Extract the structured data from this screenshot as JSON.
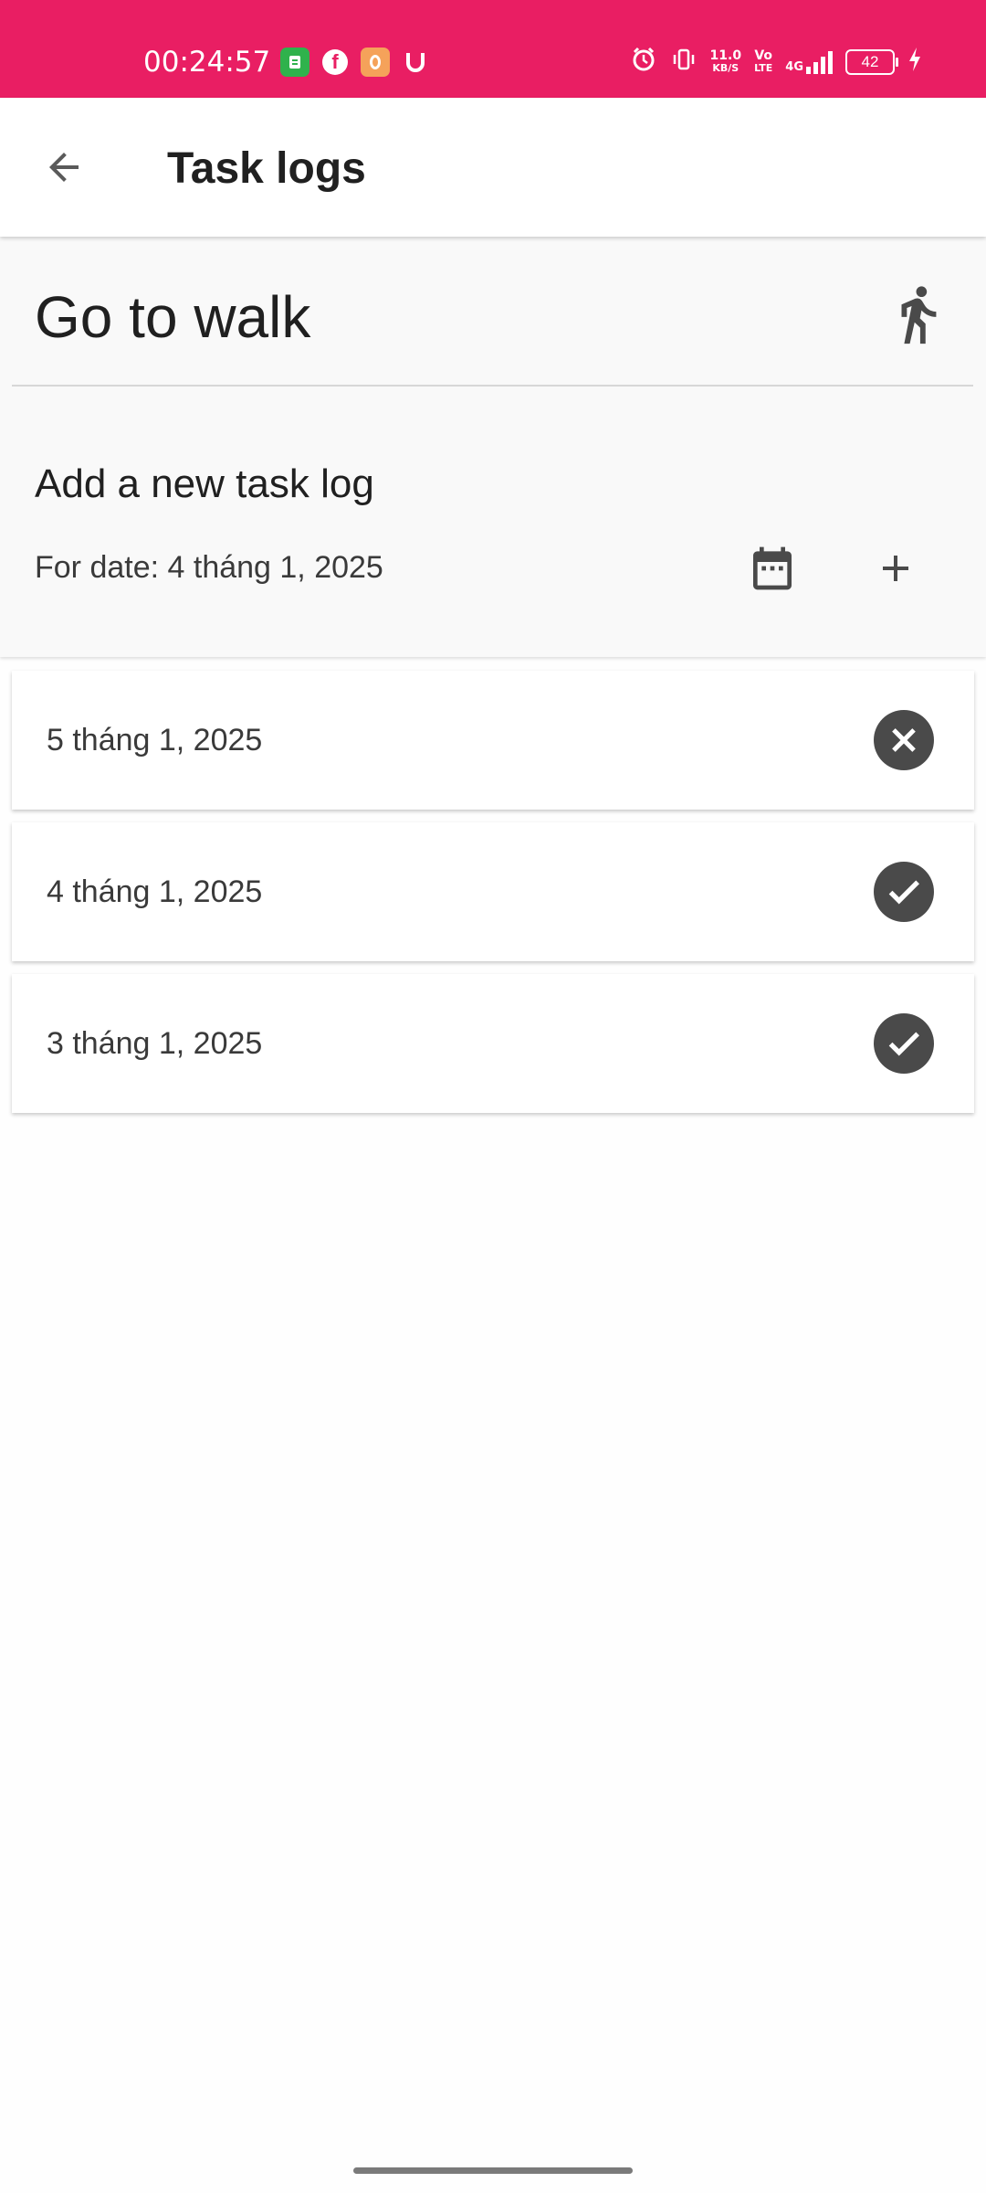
{
  "status_bar": {
    "time": "00:24:57",
    "network_speed_value": "11.0",
    "network_speed_unit": "KB/S",
    "volte_top": "Vo",
    "volte_bottom": "LTE",
    "network_type": "4G",
    "battery_level": "42",
    "background_color": "#e91e63",
    "notification_icons": [
      "app-icon",
      "facebook-icon",
      "orange-app-icon",
      "u-icon"
    ]
  },
  "app_bar": {
    "title": "Task logs"
  },
  "task": {
    "name": "Go to walk",
    "icon": "walk-icon"
  },
  "add_log": {
    "title": "Add a new task log",
    "for_date": "For date: 4 tháng 1, 2025"
  },
  "logs": [
    {
      "date": "5 tháng 1, 2025",
      "status": "missed",
      "icon": "cancel-icon"
    },
    {
      "date": "4 tháng 1, 2025",
      "status": "done",
      "icon": "check-icon"
    },
    {
      "date": "3 tháng 1, 2025",
      "status": "done",
      "icon": "check-icon"
    }
  ]
}
